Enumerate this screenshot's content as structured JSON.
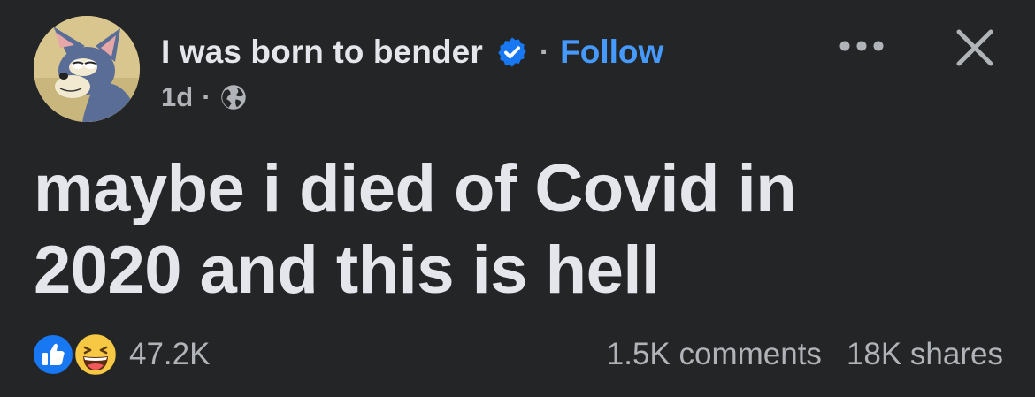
{
  "post": {
    "author_name": "I was born to bender",
    "verified": true,
    "separator": "·",
    "follow_label": "Follow",
    "time": "1d",
    "meta_separator": "·",
    "audience_icon": "globe-icon",
    "text": "maybe i died of Covid in 2020 and this is hell",
    "reactions": {
      "icons": [
        "like-icon",
        "haha-icon"
      ],
      "count": "47.2K"
    },
    "comments": "1.5K comments",
    "shares": "18K shares"
  },
  "icons": {
    "more": "more-options-icon",
    "close": "close-icon"
  },
  "colors": {
    "background": "#242526",
    "primary_text": "#e4e6eb",
    "secondary_text": "#b0b3b8",
    "link": "#4599ff",
    "verified_badge": "#1877f2"
  }
}
